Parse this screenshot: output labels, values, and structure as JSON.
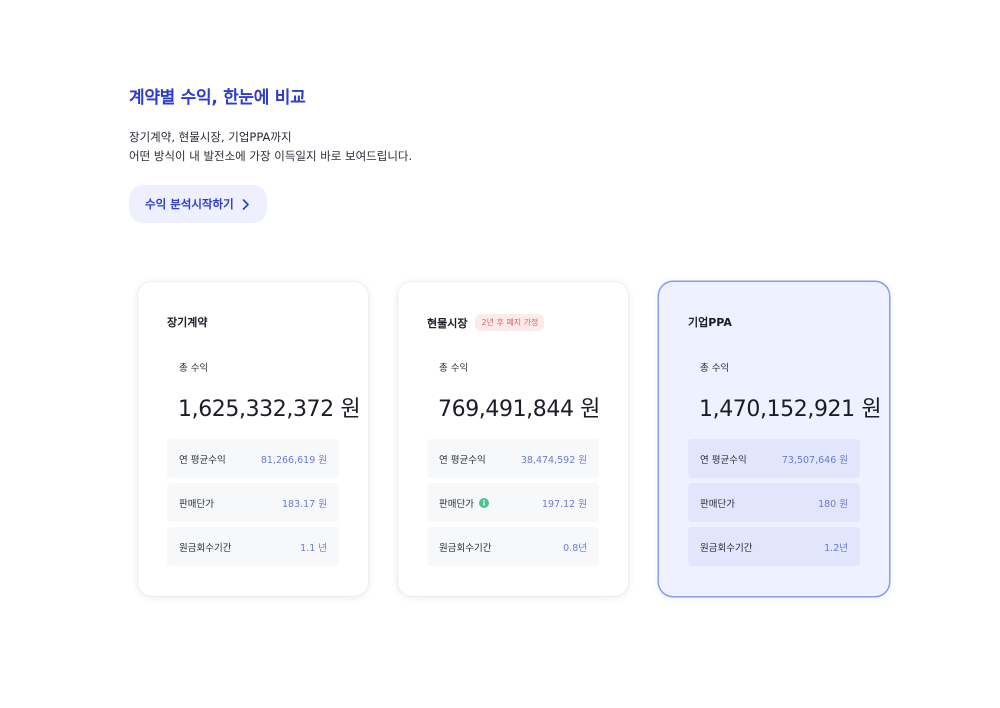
{
  "hero": {
    "title": "계약별 수익, 한눈에 비교",
    "desc_line1": "장기계약, 현물시장, 기업PPA까지",
    "desc_line2": "어떤 방식이 내 발전소에 가장 이득일지 바로 보여드립니다.",
    "cta_label": "수익 분석시작하기"
  },
  "cards": [
    {
      "title": "장기계약",
      "total_label": "총 수익",
      "total_value": "1,625,332,372 원",
      "rows": [
        {
          "label": "연 평균수익",
          "value": "81,266,619 원"
        },
        {
          "label": "판매단가",
          "value": "183.17 원"
        },
        {
          "label": "원금회수기간",
          "value": "1.1 년"
        }
      ]
    },
    {
      "title": "현물시장",
      "badge": "2년 후 폐지 가정",
      "total_label": "총 수익",
      "total_value": "769,491,844 원",
      "rows": [
        {
          "label": "연 평균수익",
          "value": "38,474,592 원"
        },
        {
          "label": "판매단가",
          "value": "197.12 원"
        },
        {
          "label": "원금회수기간",
          "value": "0.8년"
        }
      ]
    },
    {
      "title": "기업PPA",
      "total_label": "총 수익",
      "total_value": "1,470,152,921 원",
      "rows": [
        {
          "label": "연 평균수익",
          "value": "73,507,646 원"
        },
        {
          "label": "판매단가",
          "value": "180 원"
        },
        {
          "label": "원금회수기간",
          "value": "1.2년"
        }
      ]
    }
  ],
  "colors": {
    "accent": "#2d3ccf",
    "value": "#6a7bd4",
    "badge_text": "#e36363",
    "info_icon": "#4cc48e"
  },
  "icons": {
    "cta": "chevron-right-icon",
    "price_info": "info-icon"
  }
}
